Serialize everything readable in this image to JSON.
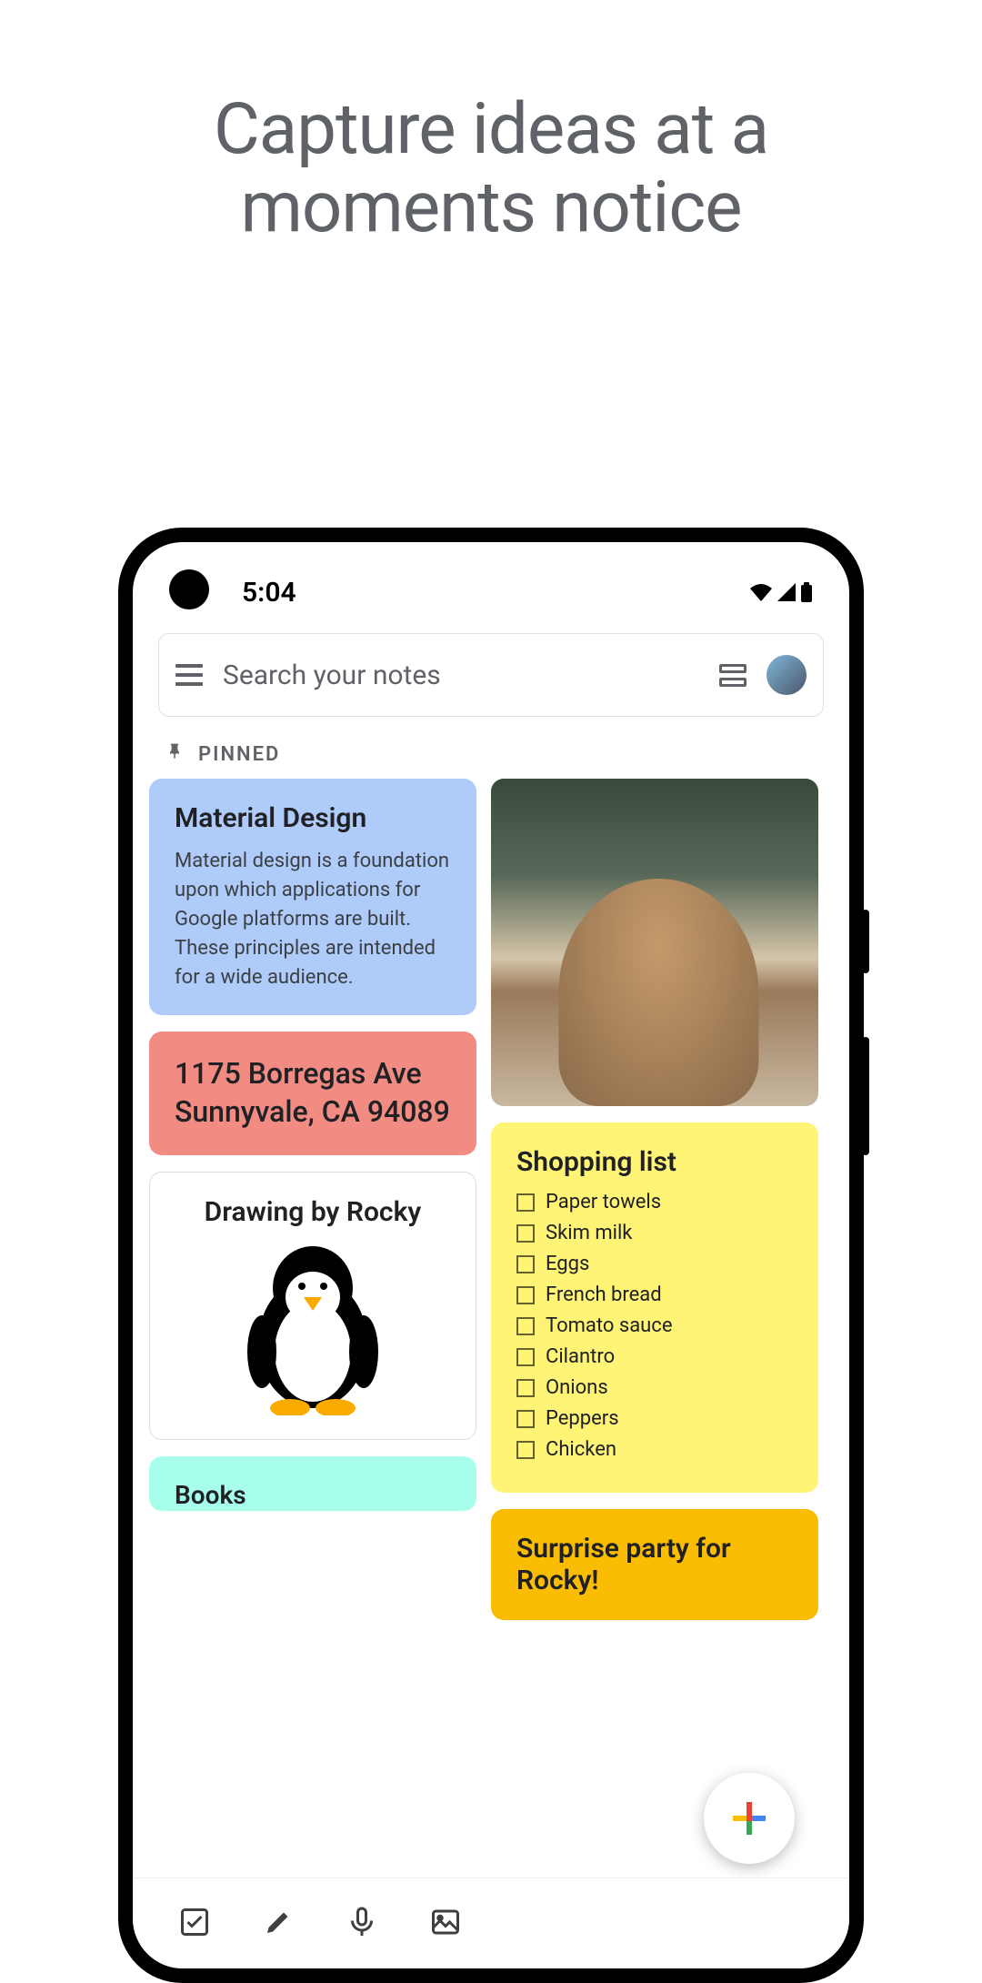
{
  "hero": {
    "line1": "Capture ideas at a",
    "line2": "moments notice"
  },
  "status": {
    "time": "5:04"
  },
  "search": {
    "placeholder": "Search your notes"
  },
  "section": {
    "pinned_label": "PINNED"
  },
  "notes": {
    "material": {
      "title": "Material Design",
      "body": "Material design is a foundation upon which applications for Google platforms are built. These principles are intended for a wide audience."
    },
    "address": {
      "text": "1175 Borregas Ave Sunnyvale, CA 94089"
    },
    "drawing": {
      "title": "Drawing by Rocky"
    },
    "shopping": {
      "title": "Shopping list",
      "items": [
        "Paper towels",
        "Skim milk",
        "Eggs",
        "French bread",
        "Tomato sauce",
        "Cilantro",
        "Onions",
        "Peppers",
        "Chicken"
      ]
    },
    "party": {
      "title": "Surprise party for Rocky!"
    },
    "books": {
      "title": "Books"
    }
  },
  "colors": {
    "blue": "#aecbfa",
    "pink": "#f28b82",
    "yellow": "#fff475",
    "orange": "#fbbc04",
    "teal": "#a7ffeb"
  }
}
